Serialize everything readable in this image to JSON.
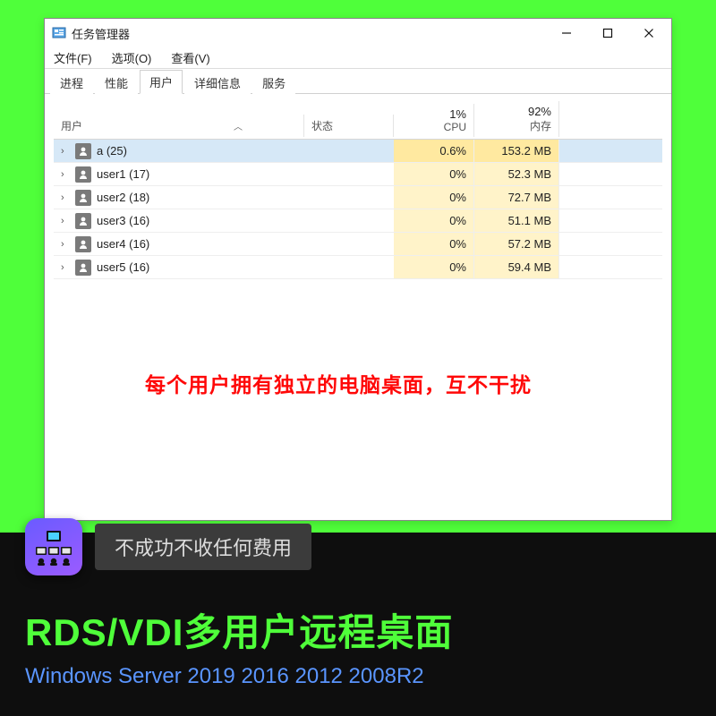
{
  "window": {
    "title": "任务管理器",
    "menus": [
      "文件(F)",
      "选项(O)",
      "查看(V)"
    ],
    "tabs": [
      "进程",
      "性能",
      "用户",
      "详细信息",
      "服务"
    ],
    "active_tab_index": 2,
    "columns": {
      "user": "用户",
      "status": "状态",
      "cpu_label": "CPU",
      "cpu_pct": "1%",
      "mem_label": "内存",
      "mem_pct": "92%"
    },
    "rows": [
      {
        "name": "a (25)",
        "cpu": "0.6%",
        "mem": "153.2 MB",
        "selected": true
      },
      {
        "name": "user1 (17)",
        "cpu": "0%",
        "mem": "52.3 MB",
        "selected": false
      },
      {
        "name": "user2 (18)",
        "cpu": "0%",
        "mem": "72.7 MB",
        "selected": false
      },
      {
        "name": "user3 (16)",
        "cpu": "0%",
        "mem": "51.1 MB",
        "selected": false
      },
      {
        "name": "user4 (16)",
        "cpu": "0%",
        "mem": "57.2 MB",
        "selected": false
      },
      {
        "name": "user5 (16)",
        "cpu": "0%",
        "mem": "59.4 MB",
        "selected": false
      }
    ]
  },
  "red_note": "每个用户拥有独立的电脑桌面，互不干扰",
  "promo": {
    "badge_text": "不成功不收任何费用",
    "title": "RDS/VDI多用户远程桌面",
    "subtitle": "Windows Server 2019 2016 2012 2008R2"
  }
}
